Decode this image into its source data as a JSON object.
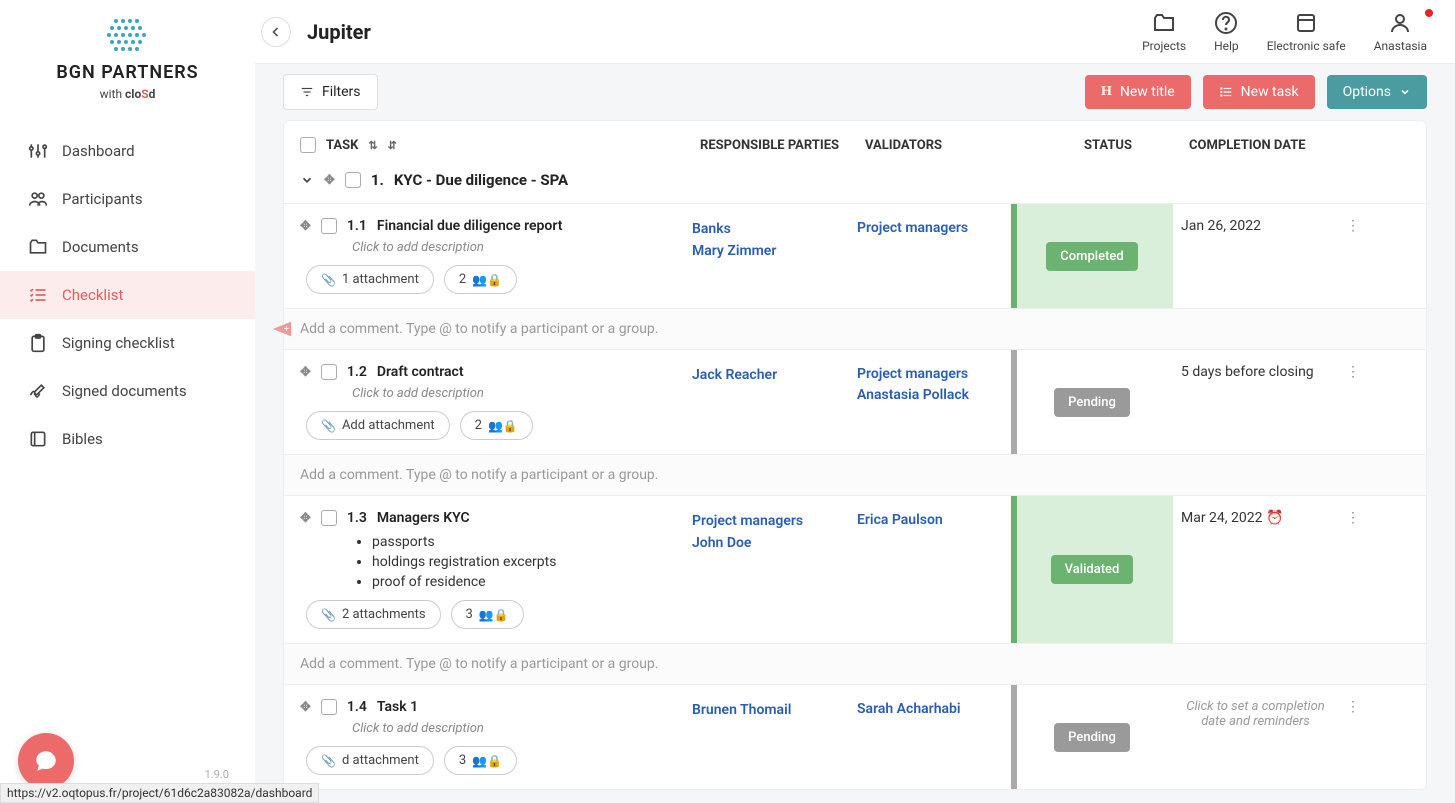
{
  "logo": {
    "company": "BGN PARTNERS",
    "with": "with",
    "product_prefix": "clo",
    "product_s": "S",
    "product_suffix": "d"
  },
  "nav": {
    "dashboard": "Dashboard",
    "participants": "Participants",
    "documents": "Documents",
    "checklist": "Checklist",
    "signing": "Signing checklist",
    "signed": "Signed documents",
    "bibles": "Bibles"
  },
  "version": "1.9.0",
  "status_url": "https://v2.oqtopus.fr/project/61d6c2a83082a/dashboard",
  "page_title": "Jupiter",
  "top_actions": {
    "projects": "Projects",
    "help": "Help",
    "safe": "Electronic safe",
    "user": "Anastasia"
  },
  "toolbar": {
    "filters": "Filters",
    "new_title": "New title",
    "new_task": "New task",
    "options": "Options"
  },
  "columns": {
    "task": "TASK",
    "resp": "RESPONSIBLE PARTIES",
    "val": "VALIDATORS",
    "status": "STATUS",
    "date": "COMPLETION DATE"
  },
  "section": {
    "num": "1.",
    "title": "KYC - Due diligence - SPA"
  },
  "comment_placeholder": "Add a comment. Type @ to notify a participant or a group.",
  "desc_placeholder": "Click to add description",
  "add_attachment": "Add attachment",
  "tasks": [
    {
      "num": "1.1",
      "title": "Financial due diligence report",
      "resp": [
        "Banks",
        "Mary Zimmer"
      ],
      "val": [
        "Project managers"
      ],
      "status": "Completed",
      "status_kind": "green-bg",
      "date": "Jan 26, 2022",
      "attachments_label": "1 attachment",
      "share_count": "2"
    },
    {
      "num": "1.2",
      "title": "Draft contract",
      "resp": [
        "Jack Reacher"
      ],
      "val": [
        "Project managers Anastasia Pollack"
      ],
      "status": "Pending",
      "status_kind": "grey",
      "date": "5 days before closing",
      "attachments_label": "Add attachment",
      "share_count": "2"
    },
    {
      "num": "1.3",
      "title": "Managers KYC",
      "resp": [
        "Project managers",
        "John Doe"
      ],
      "val": [
        "Erica Paulson"
      ],
      "status": "Validated",
      "status_kind": "green-bg",
      "date": "Mar 24, 2022",
      "has_reminder": true,
      "bullets": [
        "passports",
        "holdings registration excerpts",
        "proof of residence"
      ],
      "attachments_label": "2 attachments",
      "share_count": "3"
    },
    {
      "num": "1.4",
      "title": "Task 1",
      "resp": [
        "Brunen Thomail"
      ],
      "val": [
        "Sarah Acharhabi"
      ],
      "status": "Pending",
      "status_kind": "grey",
      "date_hint": "Click to set a completion date and reminders",
      "attachments_label": "d attachment",
      "share_count": "3"
    }
  ]
}
